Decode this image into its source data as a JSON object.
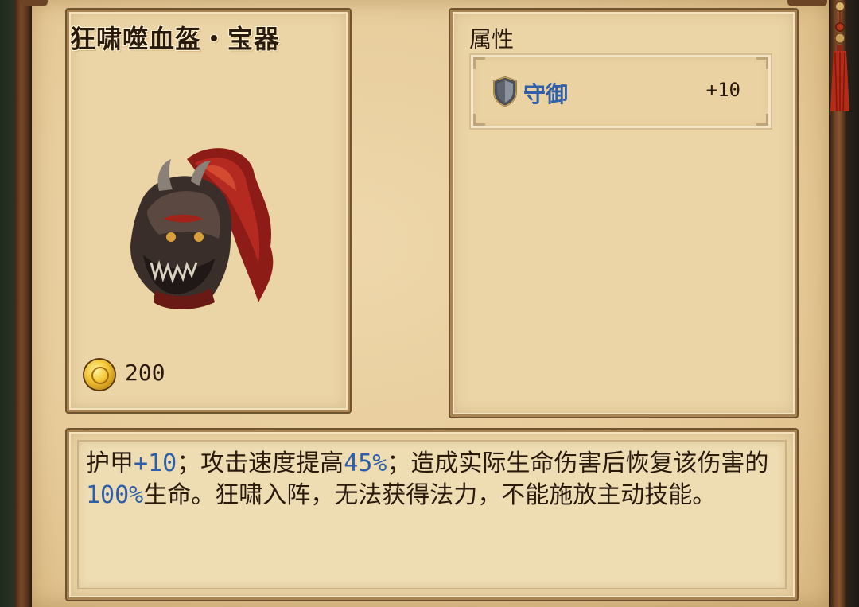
{
  "item": {
    "title": "狂啸噬血盔・宝器",
    "icon": "red-plumed-beast-helmet",
    "price": "200",
    "currency_icon": "gold-coin-icon"
  },
  "attributes": {
    "header": "属性",
    "rows": [
      {
        "icon": "shield-icon",
        "name": "守御",
        "value": "+10"
      }
    ]
  },
  "description": {
    "segments": [
      {
        "text": "护甲",
        "highlight": false
      },
      {
        "text": "+10",
        "highlight": true
      },
      {
        "text": "；攻击速度提高",
        "highlight": false
      },
      {
        "text": "45%",
        "highlight": true
      },
      {
        "text": "；造成实际生命伤害后恢复该伤害的",
        "highlight": false
      },
      {
        "text": "100%",
        "highlight": true
      },
      {
        "text": "生命。狂啸入阵，无法获得法力，不能施放主动技能。",
        "highlight": false
      }
    ]
  },
  "colors": {
    "highlight": "#2f5fa8",
    "text": "#2a1a0c",
    "parchment": "#ebd4a6"
  }
}
